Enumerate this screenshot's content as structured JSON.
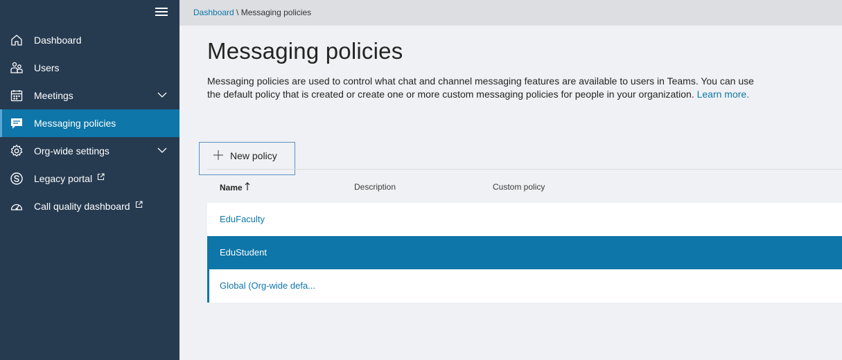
{
  "sidebar": {
    "items": [
      {
        "label": "Dashboard",
        "icon": "home-icon"
      },
      {
        "label": "Users",
        "icon": "users-icon"
      },
      {
        "label": "Meetings",
        "icon": "calendar-icon",
        "expandable": true
      },
      {
        "label": "Messaging policies",
        "icon": "chat-icon",
        "active": true
      },
      {
        "label": "Org-wide settings",
        "icon": "gear-icon",
        "expandable": true
      },
      {
        "label": "Legacy portal",
        "icon": "skype-icon",
        "external": true
      },
      {
        "label": "Call quality dashboard",
        "icon": "gauge-icon",
        "external": true
      }
    ]
  },
  "breadcrumb": {
    "root": "Dashboard",
    "separator": " \\ ",
    "current": "Messaging policies"
  },
  "page": {
    "title": "Messaging policies",
    "description": "Messaging policies are used to control what chat and channel messaging features are available to users in Teams. You can use the default policy that is created or create one or more custom messaging policies for people in your organization.",
    "learn_more": "Learn more."
  },
  "toolbar": {
    "new_policy_label": "New policy"
  },
  "table": {
    "columns": [
      "Name",
      "Description",
      "Custom policy"
    ],
    "rows": [
      {
        "name": "EduFaculty"
      },
      {
        "name": "EduStudent",
        "selected": true
      },
      {
        "name": "Global (Org-wide defa..."
      }
    ]
  },
  "colors": {
    "sidebar_bg": "#263b50",
    "accent": "#0e76a8",
    "page_bg": "#eff1f4"
  }
}
